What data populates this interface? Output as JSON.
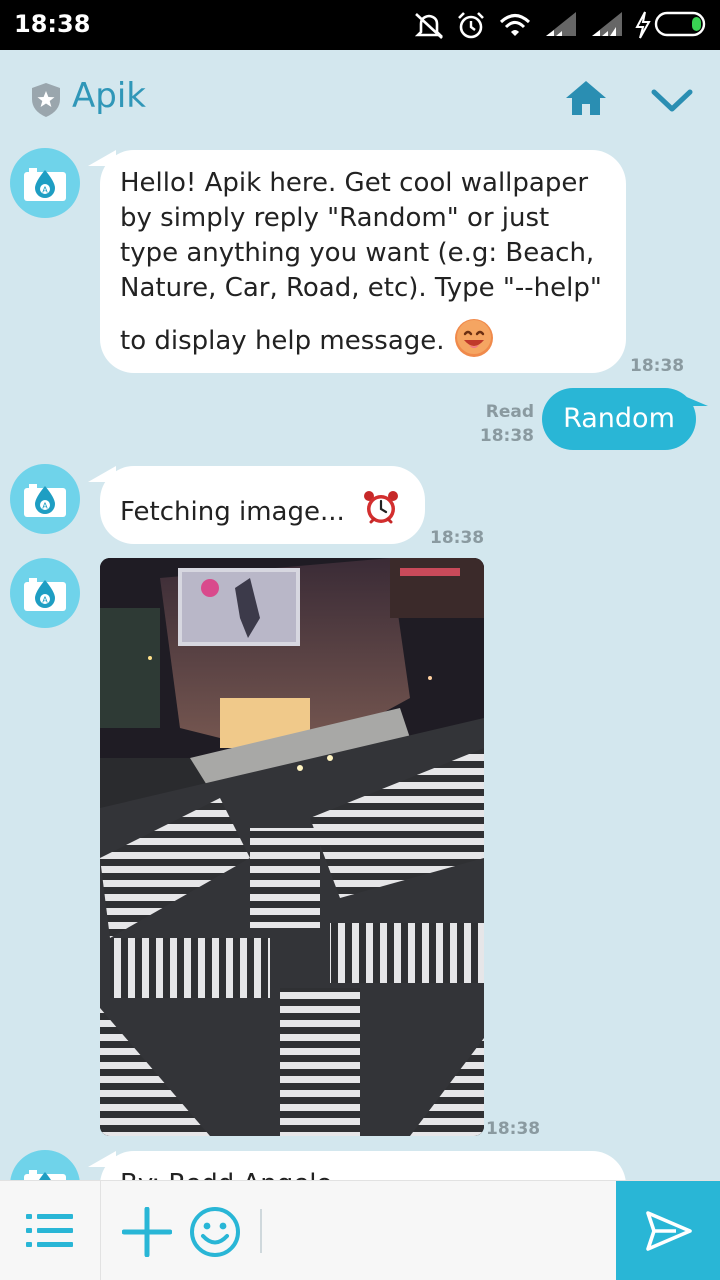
{
  "status_bar": {
    "time": "18:38",
    "icons": [
      "mute-icon",
      "alarm-icon",
      "wifi-icon",
      "signal-icon",
      "signal-icon",
      "charging-icon",
      "battery-icon"
    ]
  },
  "header": {
    "title": "Apik",
    "icons": [
      "shield-star-icon",
      "home-icon",
      "chevron-down-icon"
    ]
  },
  "messages": [
    {
      "from": "bot",
      "lines": [
        "Hello! Apik here. Get cool wallpaper",
        "by simply reply \"Random\" or just",
        "type anything you want (e.g: Beach,",
        "Nature, Car, Road, etc). Type \"--help\"",
        "to display help message."
      ],
      "emoji": "smiling-face-icon",
      "time": "18:38"
    },
    {
      "from": "user",
      "text": "Random",
      "read_label": "Read",
      "time": "18:38"
    },
    {
      "from": "bot",
      "text": "Fetching image...",
      "emoji": "alarm-clock-icon",
      "time": "18:38"
    },
    {
      "from": "bot",
      "type": "image",
      "image": "city-crosswalk-night-photo",
      "time": "18:38"
    },
    {
      "from": "bot",
      "text": "By: Redd Angelo"
    }
  ],
  "composer": {
    "icons": [
      "menu-icon",
      "plus-icon",
      "emoji-icon",
      "send-icon"
    ],
    "accent": "#29b6d6"
  },
  "colors": {
    "background": "#d3e7ee",
    "bubble_incoming": "#ffffff",
    "bubble_outgoing": "#29b6d6",
    "title": "#3097b8",
    "timestamp": "#8a9aa0"
  }
}
